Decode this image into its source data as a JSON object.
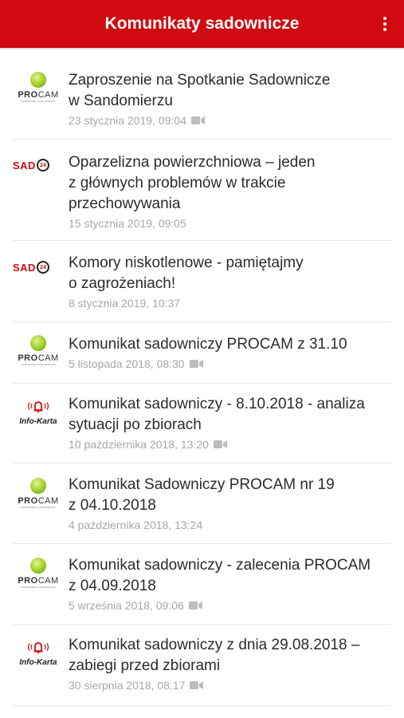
{
  "header": {
    "title": "Komunikaty sadownicze",
    "menu_icon": "more-vert-icon"
  },
  "brands": {
    "procam": {
      "word_a": "PRO",
      "word_b": "CAM",
      "sub": "AGRONOMIA SADOWNICZA"
    },
    "sad24": {
      "word": "SAD",
      "badge": "24"
    },
    "infokarta": {
      "word": "Info-Karta"
    }
  },
  "colors": {
    "accent": "#d10a11",
    "meta": "#a7a7a7",
    "title": "#2b2b2b"
  },
  "items": [
    {
      "source": "procam",
      "title_lines": [
        "Zaproszenie na Spotkanie Sadownicze",
        "w Sandomierzu"
      ],
      "date": "23 stycznia 2019, 09:04",
      "video": true
    },
    {
      "source": "sad24",
      "title_lines": [
        "Oparzelizna powierzchniowa – jeden",
        "z głównych problemów w trakcie",
        "przechowywania"
      ],
      "date": "15 stycznia 2019, 09:05",
      "video": false
    },
    {
      "source": "sad24",
      "title_lines": [
        "Komory niskotlenowe - pamiętajmy",
        "o zagrożeniach!"
      ],
      "date": "8 stycznia 2019, 10:37",
      "video": false
    },
    {
      "source": "procam",
      "title_lines": [
        "Komunikat sadowniczy PROCAM z 31.10"
      ],
      "date": "5 listopada 2018, 08:30",
      "video": true
    },
    {
      "source": "infokarta",
      "title_lines": [
        "Komunikat sadowniczy - 8.10.2018 - analiza",
        "sytuacji po zbiorach"
      ],
      "date": "10 października 2018, 13:20",
      "video": true
    },
    {
      "source": "procam",
      "title_lines": [
        "Komunikat Sadowniczy PROCAM nr 19",
        "z 04.10.2018"
      ],
      "date": "4 października 2018, 13:24",
      "video": false
    },
    {
      "source": "procam",
      "title_lines": [
        "Komunikat sadowniczy - zalecenia PROCAM",
        "z 04.09.2018"
      ],
      "date": "5 września 2018, 09:06",
      "video": true
    },
    {
      "source": "infokarta",
      "title_lines": [
        "Komunikat sadowniczy z dnia 29.08.2018 –",
        "zabiegi przed zbiorami"
      ],
      "date": "30 sierpnia 2018, 08:17",
      "video": true
    }
  ]
}
